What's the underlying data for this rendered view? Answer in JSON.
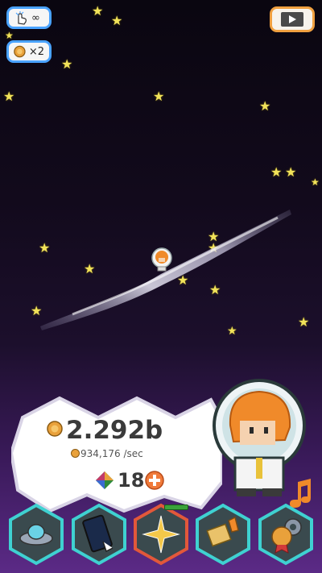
{
  "top": {
    "tap_label": "∞",
    "coin_multiplier": "×2"
  },
  "stats": {
    "coins": "2.292b",
    "per_sec": "934,176 /sec",
    "gems": "18"
  },
  "colors": {
    "accent_blue": "#4aa3ff",
    "accent_orange": "#f0a040",
    "star": "#f2e35a",
    "hex_border": "#3fd1d1",
    "hex_active_border": "#e2583a"
  },
  "icons": {
    "tap": "hand-tap-icon",
    "coin": "coin-icon",
    "video": "video-ad-icon",
    "gem": "gem-icon",
    "plus": "plus-icon",
    "music": "music-note-icon",
    "ufo": "ufo-icon",
    "phone": "phone-icon",
    "star": "sparkle-icon",
    "rocket": "rocket-icon",
    "medal": "medal-settings-icon"
  }
}
